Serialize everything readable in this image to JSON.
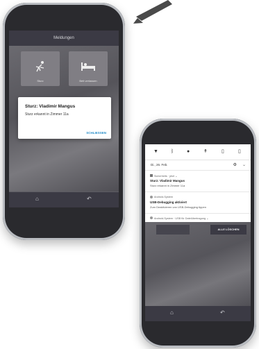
{
  "phone_left": {
    "app_title": "Meldungen",
    "tiles": [
      {
        "label": "Sturz",
        "icon": "falling-person-icon"
      },
      {
        "label": "Bett verlassen",
        "icon": "bed-icon"
      }
    ],
    "dialog": {
      "title": "Sturz: Vladimir Mangus",
      "body": "Sturz erkannt in Zimmer 11a",
      "button_label": "SCHLIESSEN"
    },
    "nav": {
      "home_icon": "home-icon",
      "back_icon": "back-icon"
    }
  },
  "phone_right": {
    "quick_settings": [
      "wifi-icon",
      "bluetooth-icon",
      "do-not-disturb-icon",
      "flashlight-icon",
      "rotate-icon",
      "battery-icon"
    ],
    "date": "Di., 26. Feb.",
    "notifications": [
      {
        "source": "Sicherheits · jetzt ⌄",
        "title": "Sturz: Vladimir Mangus",
        "body": "Sturz erkannt in Zimmer 11a"
      },
      {
        "source": "Android-System",
        "title": "USB-Debugging aktiviert",
        "body": "Zum Deaktivieren von USB-Debugging tippen"
      },
      {
        "source": "Android-System · USB für Dateiübertragung ⌄",
        "title": "",
        "body": ""
      }
    ],
    "clear_all_label": "ALLE LÖSCHEN",
    "nav": {
      "home_icon": "home-icon",
      "back_icon": "back-icon"
    }
  },
  "colors": {
    "accent": "#2a8fc9",
    "appbar": "#3b3a44",
    "phone_frame": "#2a2a2e"
  }
}
